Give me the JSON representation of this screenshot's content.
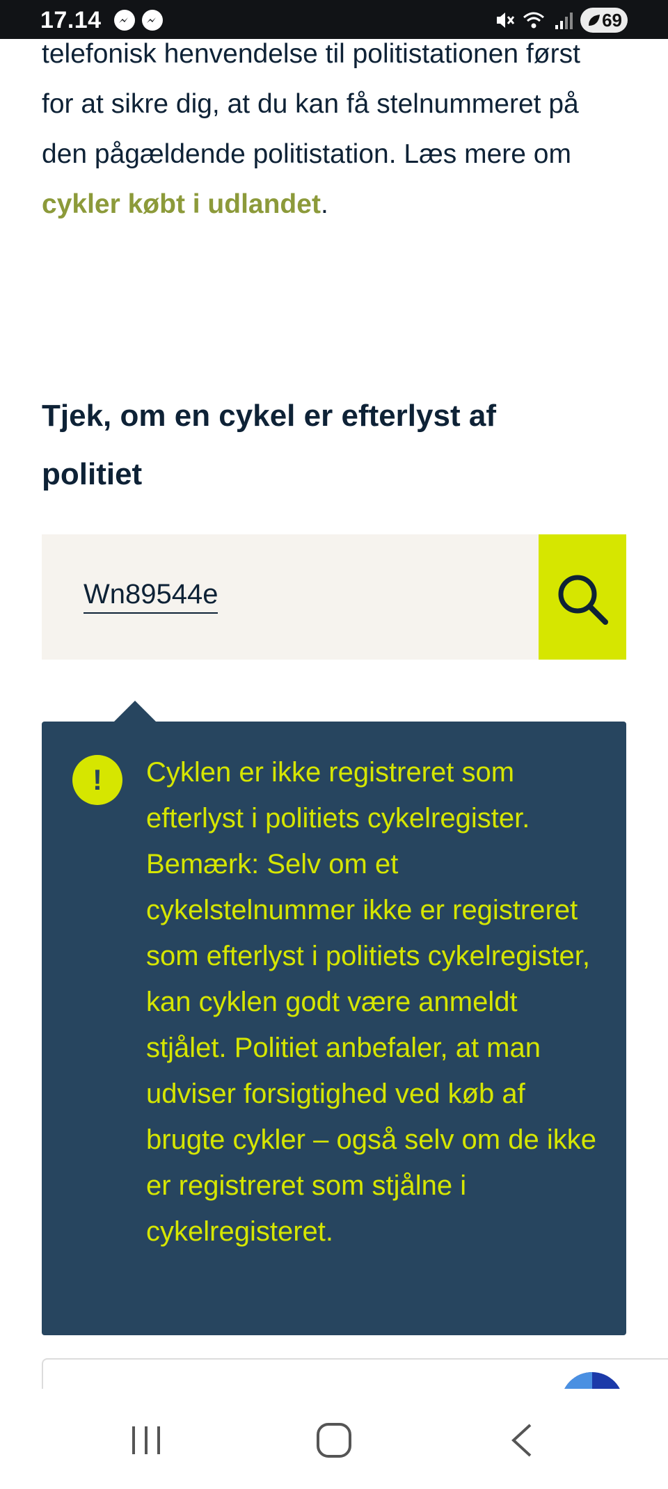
{
  "status_bar": {
    "time": "17.14",
    "battery": "69",
    "left_icons": [
      "messenger-icon",
      "messenger-icon"
    ],
    "right_icons": [
      "mute-icon",
      "wifi-icon",
      "signal-icon",
      "battery-icon"
    ]
  },
  "article": {
    "paragraph_text": "telefonisk henvendelse til politistationen først for at sikre dig, at du kan få stelnummeret på den pågældende politistation. Læs mere om ",
    "link_text": "cykler købt i udlandet",
    "paragraph_end": "."
  },
  "check": {
    "heading": "Tjek, om en cykel er efterlyst af politiet",
    "search_value": "Wn89544e",
    "search_icon": "search-icon"
  },
  "alert": {
    "icon_symbol": "!",
    "message": "Cyklen er ikke registreret som efterlyst i politiets cykelregister. Bemærk: Selv om et cykelstelnummer ikke er registreret som efterlyst i politiets cykelregister, kan cyklen godt være anmeldt stjålet. Politiet anbefaler, at man udviser forsigtighed ved køb af brugte cykler – også selv om de ikke er registreret som stjålne i cykelregisteret."
  },
  "colors": {
    "accent_yellow": "#d6e600",
    "alert_bg": "#27455f",
    "link_olive": "#8c9a3a",
    "search_bg": "#f6f3ee",
    "text_dark": "#0e2236"
  },
  "nav": {
    "items": [
      "recent-apps-icon",
      "home-icon",
      "back-icon"
    ]
  }
}
